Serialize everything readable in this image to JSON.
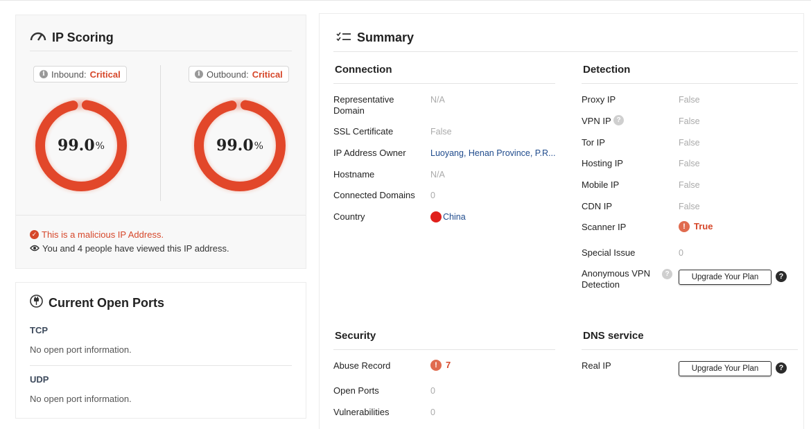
{
  "ip_scoring": {
    "title": "IP Scoring",
    "inbound": {
      "label": "Inbound:",
      "status": "Critical",
      "score": "99.0",
      "unit": "%"
    },
    "outbound": {
      "label": "Outbound:",
      "status": "Critical",
      "score": "99.0",
      "unit": "%"
    },
    "malicious_note": "This is a malicious IP Address.",
    "viewers_note": "You and 4 people have viewed this IP address.",
    "accent_color": "#e2472a"
  },
  "ports": {
    "title": "Current Open Ports",
    "tcp_label": "TCP",
    "tcp_text": "No open port information.",
    "udp_label": "UDP",
    "udp_text": "No open port information."
  },
  "summary": {
    "title": "Summary",
    "connection": {
      "title": "Connection",
      "rows": [
        {
          "label": "Representative Domain",
          "value": "N/A"
        },
        {
          "label": "SSL Certificate",
          "value": "False"
        },
        {
          "label": "IP Address Owner",
          "value": "Luoyang, Henan Province, P.R..."
        },
        {
          "label": "Hostname",
          "value": "N/A"
        },
        {
          "label": "Connected Domains",
          "value": "0"
        },
        {
          "label": "Country",
          "value": "China"
        }
      ]
    },
    "detection": {
      "title": "Detection",
      "rows": [
        {
          "label": "Proxy IP",
          "value": "False"
        },
        {
          "label": "VPN IP",
          "value": "False"
        },
        {
          "label": "Tor IP",
          "value": "False"
        },
        {
          "label": "Hosting IP",
          "value": "False"
        },
        {
          "label": "Mobile IP",
          "value": "False"
        },
        {
          "label": "CDN IP",
          "value": "False"
        },
        {
          "label": "Scanner IP",
          "value": "True"
        },
        {
          "label": "Special Issue",
          "value": "0"
        },
        {
          "label": "Anonymous VPN Detection",
          "value": "Upgrade Your Plan"
        }
      ]
    },
    "security": {
      "title": "Security",
      "rows": [
        {
          "label": "Abuse Record",
          "value": "7"
        },
        {
          "label": "Open Ports",
          "value": "0"
        },
        {
          "label": "Vulnerabilities",
          "value": "0"
        }
      ]
    },
    "dns": {
      "title": "DNS service",
      "rows": [
        {
          "label": "Real IP",
          "value": "Upgrade Your Plan"
        }
      ]
    }
  }
}
